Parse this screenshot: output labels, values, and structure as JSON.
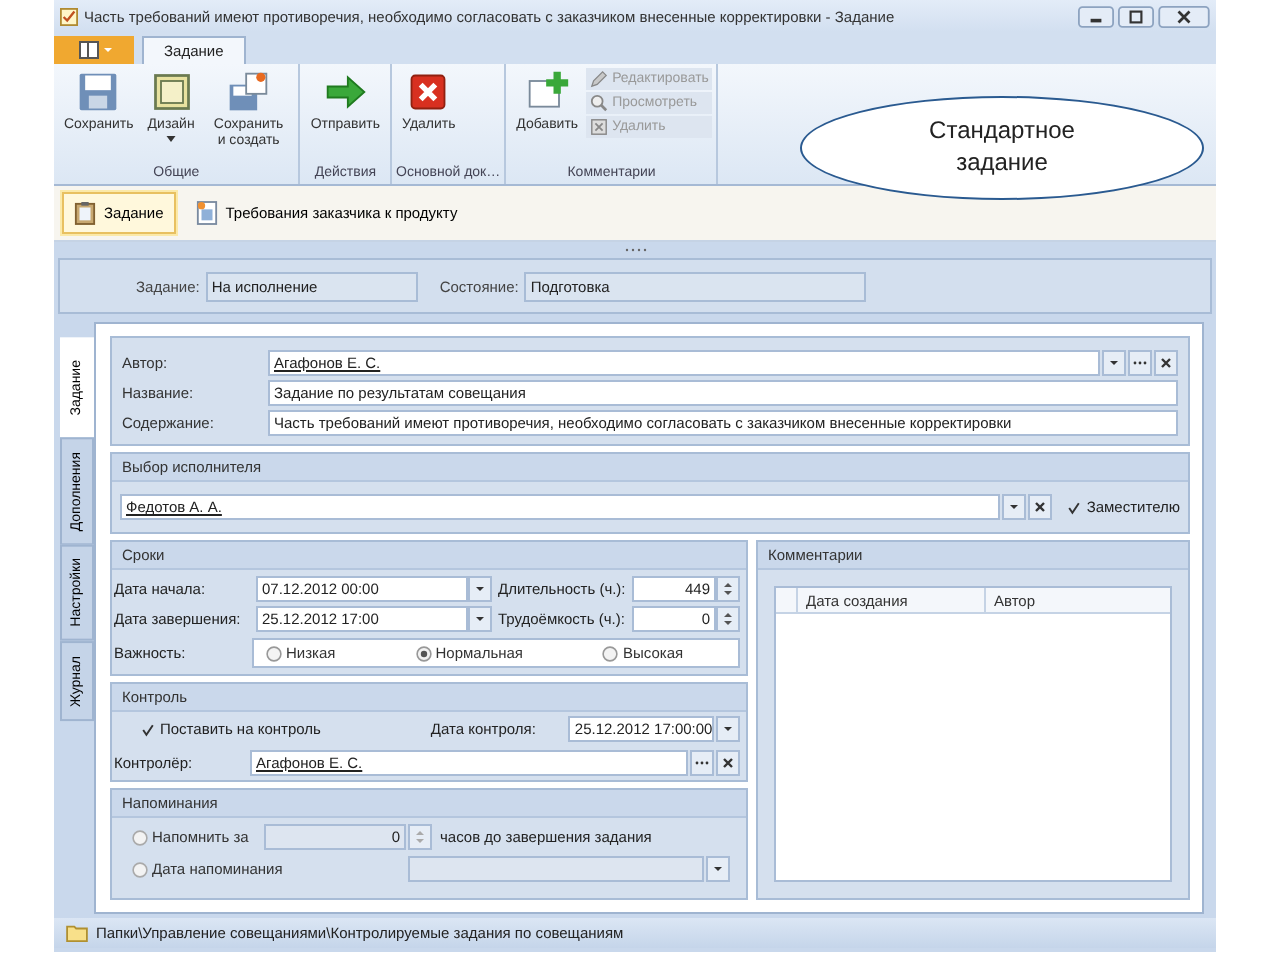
{
  "window": {
    "title": "Часть требований имеют противоречия, необходимо согласовать с заказчиком внесенные корректировки - Задание"
  },
  "ribbon": {
    "tabs": [
      {
        "label": "Задание",
        "selected": true
      }
    ],
    "groups": [
      {
        "label": "Общие",
        "buttons": [
          {
            "label": "Сохранить",
            "kind": "large",
            "disabled": false
          },
          {
            "label": "Дизайн",
            "kind": "large",
            "disabled": false
          },
          {
            "label": "Сохранить и создать",
            "kind": "large",
            "disabled": false
          }
        ]
      },
      {
        "label": "Действия",
        "buttons": [
          {
            "label": "Отправить",
            "kind": "large",
            "disabled": false
          }
        ]
      },
      {
        "label": "Основной док…",
        "buttons": [
          {
            "label": "Удалить",
            "kind": "large",
            "disabled": false
          }
        ]
      },
      {
        "label": "Комментарии",
        "buttons": [
          {
            "label": "Добавить",
            "kind": "large",
            "disabled": false
          },
          {
            "label": "Редактировать",
            "kind": "small",
            "disabled": true
          },
          {
            "label": "Просмотреть",
            "kind": "small",
            "disabled": true
          },
          {
            "label": "Удалить",
            "kind": "small",
            "disabled": true
          }
        ]
      }
    ]
  },
  "callout": {
    "text": "Стандартное задание"
  },
  "nav_tabs": [
    {
      "label": "Задание",
      "selected": true
    },
    {
      "label": "Требования заказчика к продукту",
      "selected": false
    }
  ],
  "header": {
    "fields": [
      {
        "label": "Задание:",
        "value": "На исполнение"
      },
      {
        "label": "Состояние:",
        "value": "Подготовка"
      }
    ]
  },
  "side_tabs": [
    {
      "label": "Задание",
      "selected": true
    },
    {
      "label": "Дополнения",
      "selected": false
    },
    {
      "label": "Настройки",
      "selected": false
    },
    {
      "label": "Журнал",
      "selected": false
    }
  ],
  "details": {
    "author": {
      "label": "Автор:",
      "value": "Агафонов Е. С."
    },
    "name": {
      "label": "Название:",
      "value": "Задание по результатам совещания"
    },
    "content": {
      "label": "Содержание:",
      "value": "Часть требований имеют противоречия, необходимо согласовать с заказчиком внесенные корректировки"
    }
  },
  "assignee": {
    "title": "Выбор исполнителя",
    "value": "Федотов А. А.",
    "deputy": {
      "label": "Заместителю",
      "checked": true
    }
  },
  "terms": {
    "title": "Сроки",
    "start": {
      "label": "Дата начала:",
      "value": "07.12.2012 00:00"
    },
    "duration": {
      "label": "Длительность (ч.):",
      "value": "449"
    },
    "end": {
      "label": "Дата завершения:",
      "value": "25.12.2012 17:00"
    },
    "effort": {
      "label": "Трудоёмкость (ч.):",
      "value": "0"
    },
    "importance": {
      "label": "Важность:",
      "options": [
        {
          "label": "Низкая",
          "selected": false
        },
        {
          "label": "Нормальная",
          "selected": true
        },
        {
          "label": "Высокая",
          "selected": false
        }
      ]
    }
  },
  "control": {
    "title": "Контроль",
    "on_control": {
      "label": "Поставить на контроль",
      "checked": true
    },
    "date": {
      "label": "Дата контроля:",
      "value": "25.12.2012 17:00:00"
    },
    "controller": {
      "label": "Контролёр:",
      "value": "Агафонов Е. С."
    }
  },
  "reminders": {
    "title": "Напоминания",
    "options": [
      {
        "kind": "hours",
        "label": "Напомнить за",
        "selected": false,
        "value": "0",
        "suffix": "часов до завершения задания"
      },
      {
        "kind": "date",
        "label": "Дата напоминания",
        "selected": false
      }
    ]
  },
  "comments": {
    "title": "Комментарии",
    "columns": [
      "Дата создания",
      "Автор"
    ]
  },
  "status_bar": {
    "path": "Папки\\Управление совещаниями\\Контролируемые задания по совещаниям"
  }
}
